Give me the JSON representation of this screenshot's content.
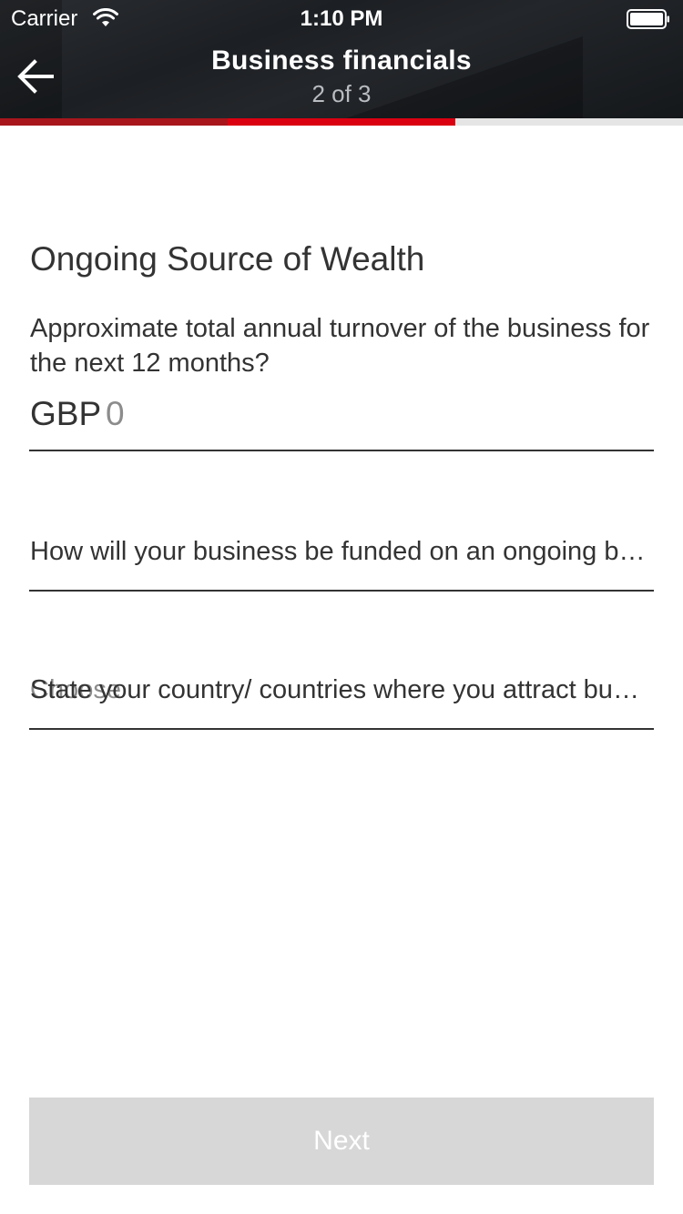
{
  "status_bar": {
    "carrier": "Carrier",
    "time": "1:10 PM"
  },
  "header": {
    "title": "Business financials",
    "step": "2 of 3",
    "back_icon": "arrow-left-icon"
  },
  "progress": {
    "total_steps": 3,
    "current_step": 2
  },
  "form": {
    "section_title": "Ongoing Source of Wealth",
    "turnover": {
      "question": "Approximate total annual turnover of the business for the next 12 months?",
      "currency": "GBP",
      "placeholder": "0"
    },
    "funding": {
      "label": "How will your business be funded on an ongoing basis?"
    },
    "countries": {
      "label": "State your country/ countries where you attract business",
      "placeholder": "Choose"
    }
  },
  "actions": {
    "next_label": "Next"
  },
  "colors": {
    "brand_red": "#db0011",
    "dark_red": "#a8161c",
    "header_bg": "#1c1f23",
    "disabled_button": "#d7d7d7"
  }
}
